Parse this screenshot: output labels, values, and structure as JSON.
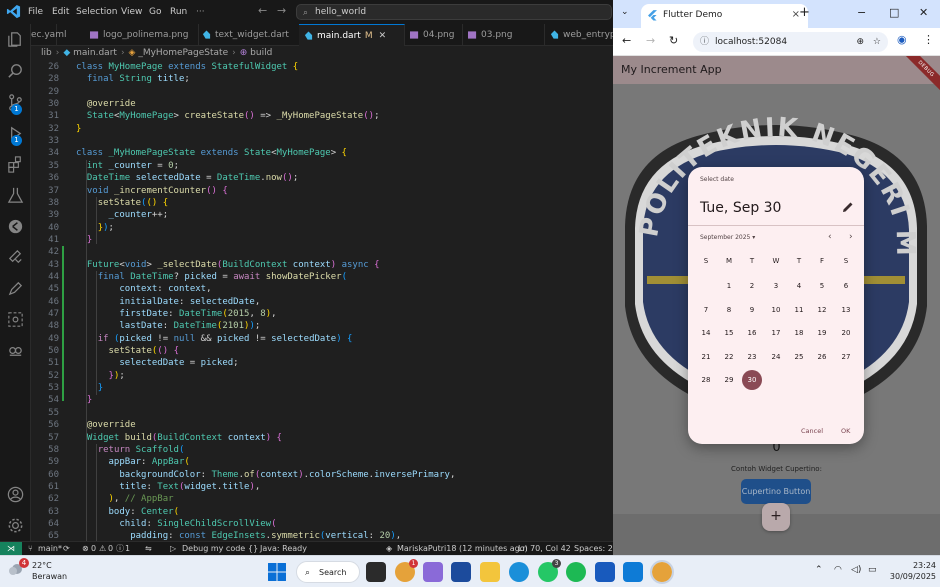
{
  "vscode": {
    "menu": [
      "File",
      "Edit",
      "Selection",
      "View",
      "Go",
      "Run"
    ],
    "more": "···",
    "search_text": "hello_world",
    "tabs": [
      {
        "label": "ec.yaml"
      },
      {
        "label": "logo_polinema.png"
      },
      {
        "label": "text_widget.dart"
      },
      {
        "label": "main.dart",
        "modified": "M",
        "close": "✕"
      },
      {
        "label": "04.png"
      },
      {
        "label": "03.png"
      },
      {
        "label": "web_entrypoint"
      }
    ],
    "breadcrumb": [
      "lib",
      "main.dart",
      "_MyHomePageState",
      "build"
    ],
    "activity_badges": {
      "source_control": "1",
      "run_debug": "1"
    },
    "code_lines": [
      {
        "n": "26",
        "html": "<span class=\"kw\">class</span> <span class=\"ty\">MyHomePage</span> <span class=\"kw\">extends</span> <span class=\"ty\">StatefulWidget</span> <span class=\"b1\">{</span>"
      },
      {
        "n": "28",
        "html": "  <span class=\"kw\">final</span> <span class=\"ty\">String</span> <span class=\"va\">title</span>;"
      },
      {
        "n": "29",
        "html": ""
      },
      {
        "n": "30",
        "html": "  <span class=\"an\">@override</span>"
      },
      {
        "n": "31",
        "html": "  <span class=\"ty\">State</span><<span class=\"ty\">MyHomePage</span>> <span class=\"fn\">createState</span><span class=\"b2\">()</span> => <span class=\"fn\">_MyHomePageState</span><span class=\"b2\">()</span>;"
      },
      {
        "n": "32",
        "html": "<span class=\"b1\">}</span>"
      },
      {
        "n": "33",
        "html": ""
      },
      {
        "n": "34",
        "html": "<span class=\"kw\">class</span> <span class=\"ty\">_MyHomePageState</span> <span class=\"kw\">extends</span> <span class=\"ty\">State</span><<span class=\"ty\">MyHomePage</span>> <span class=\"b1\">{</span>"
      },
      {
        "n": "35",
        "html": "  <span class=\"ty\">int</span> <span class=\"va\">_counter</span> = <span class=\"nu\">0</span>;"
      },
      {
        "n": "36",
        "html": "  <span class=\"ty\">DateTime</span> <span class=\"va\">selectedDate</span> = <span class=\"ty\">DateTime</span>.<span class=\"fn\">now</span><span class=\"b2\">()</span>;"
      },
      {
        "n": "37",
        "html": "  <span class=\"kw\">void</span> <span class=\"fn\">_incrementCounter</span><span class=\"b2\">()</span> <span class=\"b2\">{</span>"
      },
      {
        "n": "38",
        "html": "    <span class=\"fn\">setState</span><span class=\"b3\">(</span><span class=\"b1\">()</span> <span class=\"b1\">{</span>"
      },
      {
        "n": "39",
        "html": "      <span class=\"va\">_counter</span>++;"
      },
      {
        "n": "40",
        "html": "    <span class=\"b1\">}</span><span class=\"b3\">)</span>;"
      },
      {
        "n": "41",
        "html": "  <span class=\"b2\">}</span>"
      },
      {
        "n": "42",
        "html": ""
      },
      {
        "n": "43",
        "html": "  <span class=\"ty\">Future</span><<span class=\"kw\">void</span>> <span class=\"fn\">_selectDate</span><span class=\"b2\">(</span><span class=\"ty\">BuildContext</span> <span class=\"va\">context</span><span class=\"b2\">)</span> <span class=\"kw\">async</span> <span class=\"b2\">{</span>"
      },
      {
        "n": "44",
        "html": "    <span class=\"kw\">final</span> <span class=\"ty\">DateTime</span>? <span class=\"va\">picked</span> = <span class=\"kw2\">await</span> <span class=\"fn\">showDatePicker</span><span class=\"b3\">(</span>"
      },
      {
        "n": "45",
        "html": "        <span class=\"va\">context</span>: <span class=\"va\">context</span>,"
      },
      {
        "n": "46",
        "html": "        <span class=\"va\">initialDate</span>: <span class=\"va\">selectedDate</span>,"
      },
      {
        "n": "47",
        "html": "        <span class=\"va\">firstDate</span>: <span class=\"ty\">DateTime</span><span class=\"b1\">(</span><span class=\"nu\">2015</span>, <span class=\"nu\">8</span><span class=\"b1\">)</span>,"
      },
      {
        "n": "48",
        "html": "        <span class=\"va\">lastDate</span>: <span class=\"ty\">DateTime</span><span class=\"b1\">(</span><span class=\"nu\">2101</span><span class=\"b1\">)</span><span class=\"b3\">)</span>;"
      },
      {
        "n": "49",
        "html": "    <span class=\"kw2\">if</span> <span class=\"b3\">(</span><span class=\"va\">picked</span> != <span class=\"kw\">null</span> && <span class=\"va\">picked</span> != <span class=\"va\">selectedDate</span><span class=\"b3\">)</span> <span class=\"b3\">{</span>"
      },
      {
        "n": "50",
        "html": "      <span class=\"fn\">setState</span><span class=\"b1\">(</span><span class=\"b2\">()</span> <span class=\"b2\">{</span>"
      },
      {
        "n": "51",
        "html": "        <span class=\"va\">selectedDate</span> = <span class=\"va\">picked</span>;"
      },
      {
        "n": "52",
        "html": "      <span class=\"b2\">}</span><span class=\"b1\">)</span>;"
      },
      {
        "n": "53",
        "html": "    <span class=\"b3\">}</span>"
      },
      {
        "n": "54",
        "html": "  <span class=\"b2\">}</span>"
      },
      {
        "n": "55",
        "html": ""
      },
      {
        "n": "56",
        "html": "  <span class=\"an\">@override</span>"
      },
      {
        "n": "57",
        "html": "  <span class=\"ty\">Widget</span> <span class=\"fn\">build</span><span class=\"b2\">(</span><span class=\"ty\">BuildContext</span> <span class=\"va\">context</span><span class=\"b2\">)</span> <span class=\"b2\">{</span>"
      },
      {
        "n": "58",
        "html": "    <span class=\"kw2\">return</span> <span class=\"ty\">Scaffold</span><span class=\"b3\">(</span>"
      },
      {
        "n": "59",
        "html": "      <span class=\"va\">appBar</span>: <span class=\"ty\">AppBar</span><span class=\"b1\">(</span>"
      },
      {
        "n": "60",
        "html": "        <span class=\"va\">backgroundColor</span>: <span class=\"ty\">Theme</span>.<span class=\"fn\">of</span><span class=\"b2\">(</span><span class=\"va\">context</span><span class=\"b2\">)</span>.<span class=\"va\">colorScheme</span>.<span class=\"va\">inversePrimary</span>,"
      },
      {
        "n": "61",
        "html": "        <span class=\"va\">title</span>: <span class=\"ty\">Text</span><span class=\"b2\">(</span><span class=\"va\">widget</span>.<span class=\"va\">title</span><span class=\"b2\">)</span>,"
      },
      {
        "n": "62",
        "html": "      <span class=\"b1\">)</span>, <span class=\"cm\">// AppBar</span>"
      },
      {
        "n": "63",
        "html": "      <span class=\"va\">body</span>: <span class=\"ty\">Center</span><span class=\"b1\">(</span>"
      },
      {
        "n": "64",
        "html": "        <span class=\"va\">child</span>: <span class=\"ty\">SingleChildScrollView</span><span class=\"b2\">(</span>"
      },
      {
        "n": "65",
        "html": "          <span class=\"va\">padding</span>: <span class=\"kw\">const</span> <span class=\"ty\">EdgeInsets</span>.<span class=\"fn\">symmetric</span><span class=\"b3\">(</span><span class=\"va\">vertical</span>: <span class=\"nu\">20</span><span class=\"b3\">)</span>,"
      }
    ],
    "status": {
      "branch": "main*",
      "problems": "0",
      "warnings": "0",
      "info": "1",
      "debug": "Debug my code",
      "java": "Java: Ready",
      "blame": "MariskaPutri18 (12 minutes ago)",
      "position": "Ln 70, Col 42",
      "spaces": "Spaces: 2"
    }
  },
  "chrome": {
    "tab_title": "Flutter Demo",
    "tab_close": "×",
    "new_tab": "+",
    "url": "localhost:52084",
    "window_controls": [
      "−",
      "□",
      "✕"
    ]
  },
  "flutter_app": {
    "title": "My Increment App",
    "debug_banner": "DEBUG",
    "emblem_text": "POLITEKNIK NEGERI MALANG",
    "counter_value": "0",
    "cupertino_label": "Contoh Widget Cupertino:",
    "cupertino_button": "Cupertino Button",
    "fab_icon": "+",
    "date_picker": {
      "header": "Select date",
      "selected_date": "Tue, Sep 30",
      "month_year": "September 2025",
      "weekdays": [
        "S",
        "M",
        "T",
        "W",
        "T",
        "F",
        "S"
      ],
      "first_weekday_offset": 1,
      "days_in_month": 30,
      "selected_day": 30,
      "cancel": "Cancel",
      "ok": "OK"
    }
  },
  "taskbar": {
    "weather_temp": "22°C",
    "weather_desc": "Berawan",
    "weather_badge": "4",
    "search_label": "Search",
    "chrome_badge": "1",
    "whatsapp_badge": "3",
    "time": "23:24",
    "date": "30/09/2025"
  }
}
